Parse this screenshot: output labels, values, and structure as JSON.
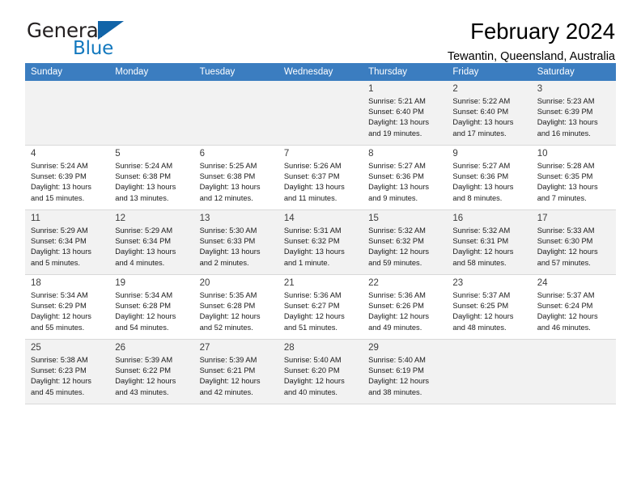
{
  "brand": {
    "name_part1": "General",
    "name_part2": "Blue",
    "flag_icon": "blue-triangle-flag",
    "accent_color": "#1278be",
    "flag_color": "#1164a8"
  },
  "header": {
    "title": "February 2024",
    "subtitle": "Tewantin, Queensland, Australia"
  },
  "calendar": {
    "header_bg": "#3b7dc0",
    "header_text_color": "#ffffff",
    "shaded_row_bg": "#f2f2f2",
    "weekdays": [
      "Sunday",
      "Monday",
      "Tuesday",
      "Wednesday",
      "Thursday",
      "Friday",
      "Saturday"
    ],
    "weeks": [
      [
        {
          "day": "",
          "lines": []
        },
        {
          "day": "",
          "lines": []
        },
        {
          "day": "",
          "lines": []
        },
        {
          "day": "",
          "lines": []
        },
        {
          "day": "1",
          "lines": [
            "Sunrise: 5:21 AM",
            "Sunset: 6:40 PM",
            "Daylight: 13 hours",
            "and 19 minutes."
          ]
        },
        {
          "day": "2",
          "lines": [
            "Sunrise: 5:22 AM",
            "Sunset: 6:40 PM",
            "Daylight: 13 hours",
            "and 17 minutes."
          ]
        },
        {
          "day": "3",
          "lines": [
            "Sunrise: 5:23 AM",
            "Sunset: 6:39 PM",
            "Daylight: 13 hours",
            "and 16 minutes."
          ]
        }
      ],
      [
        {
          "day": "4",
          "lines": [
            "Sunrise: 5:24 AM",
            "Sunset: 6:39 PM",
            "Daylight: 13 hours",
            "and 15 minutes."
          ]
        },
        {
          "day": "5",
          "lines": [
            "Sunrise: 5:24 AM",
            "Sunset: 6:38 PM",
            "Daylight: 13 hours",
            "and 13 minutes."
          ]
        },
        {
          "day": "6",
          "lines": [
            "Sunrise: 5:25 AM",
            "Sunset: 6:38 PM",
            "Daylight: 13 hours",
            "and 12 minutes."
          ]
        },
        {
          "day": "7",
          "lines": [
            "Sunrise: 5:26 AM",
            "Sunset: 6:37 PM",
            "Daylight: 13 hours",
            "and 11 minutes."
          ]
        },
        {
          "day": "8",
          "lines": [
            "Sunrise: 5:27 AM",
            "Sunset: 6:36 PM",
            "Daylight: 13 hours",
            "and 9 minutes."
          ]
        },
        {
          "day": "9",
          "lines": [
            "Sunrise: 5:27 AM",
            "Sunset: 6:36 PM",
            "Daylight: 13 hours",
            "and 8 minutes."
          ]
        },
        {
          "day": "10",
          "lines": [
            "Sunrise: 5:28 AM",
            "Sunset: 6:35 PM",
            "Daylight: 13 hours",
            "and 7 minutes."
          ]
        }
      ],
      [
        {
          "day": "11",
          "lines": [
            "Sunrise: 5:29 AM",
            "Sunset: 6:34 PM",
            "Daylight: 13 hours",
            "and 5 minutes."
          ]
        },
        {
          "day": "12",
          "lines": [
            "Sunrise: 5:29 AM",
            "Sunset: 6:34 PM",
            "Daylight: 13 hours",
            "and 4 minutes."
          ]
        },
        {
          "day": "13",
          "lines": [
            "Sunrise: 5:30 AM",
            "Sunset: 6:33 PM",
            "Daylight: 13 hours",
            "and 2 minutes."
          ]
        },
        {
          "day": "14",
          "lines": [
            "Sunrise: 5:31 AM",
            "Sunset: 6:32 PM",
            "Daylight: 13 hours",
            "and 1 minute."
          ]
        },
        {
          "day": "15",
          "lines": [
            "Sunrise: 5:32 AM",
            "Sunset: 6:32 PM",
            "Daylight: 12 hours",
            "and 59 minutes."
          ]
        },
        {
          "day": "16",
          "lines": [
            "Sunrise: 5:32 AM",
            "Sunset: 6:31 PM",
            "Daylight: 12 hours",
            "and 58 minutes."
          ]
        },
        {
          "day": "17",
          "lines": [
            "Sunrise: 5:33 AM",
            "Sunset: 6:30 PM",
            "Daylight: 12 hours",
            "and 57 minutes."
          ]
        }
      ],
      [
        {
          "day": "18",
          "lines": [
            "Sunrise: 5:34 AM",
            "Sunset: 6:29 PM",
            "Daylight: 12 hours",
            "and 55 minutes."
          ]
        },
        {
          "day": "19",
          "lines": [
            "Sunrise: 5:34 AM",
            "Sunset: 6:28 PM",
            "Daylight: 12 hours",
            "and 54 minutes."
          ]
        },
        {
          "day": "20",
          "lines": [
            "Sunrise: 5:35 AM",
            "Sunset: 6:28 PM",
            "Daylight: 12 hours",
            "and 52 minutes."
          ]
        },
        {
          "day": "21",
          "lines": [
            "Sunrise: 5:36 AM",
            "Sunset: 6:27 PM",
            "Daylight: 12 hours",
            "and 51 minutes."
          ]
        },
        {
          "day": "22",
          "lines": [
            "Sunrise: 5:36 AM",
            "Sunset: 6:26 PM",
            "Daylight: 12 hours",
            "and 49 minutes."
          ]
        },
        {
          "day": "23",
          "lines": [
            "Sunrise: 5:37 AM",
            "Sunset: 6:25 PM",
            "Daylight: 12 hours",
            "and 48 minutes."
          ]
        },
        {
          "day": "24",
          "lines": [
            "Sunrise: 5:37 AM",
            "Sunset: 6:24 PM",
            "Daylight: 12 hours",
            "and 46 minutes."
          ]
        }
      ],
      [
        {
          "day": "25",
          "lines": [
            "Sunrise: 5:38 AM",
            "Sunset: 6:23 PM",
            "Daylight: 12 hours",
            "and 45 minutes."
          ]
        },
        {
          "day": "26",
          "lines": [
            "Sunrise: 5:39 AM",
            "Sunset: 6:22 PM",
            "Daylight: 12 hours",
            "and 43 minutes."
          ]
        },
        {
          "day": "27",
          "lines": [
            "Sunrise: 5:39 AM",
            "Sunset: 6:21 PM",
            "Daylight: 12 hours",
            "and 42 minutes."
          ]
        },
        {
          "day": "28",
          "lines": [
            "Sunrise: 5:40 AM",
            "Sunset: 6:20 PM",
            "Daylight: 12 hours",
            "and 40 minutes."
          ]
        },
        {
          "day": "29",
          "lines": [
            "Sunrise: 5:40 AM",
            "Sunset: 6:19 PM",
            "Daylight: 12 hours",
            "and 38 minutes."
          ]
        },
        {
          "day": "",
          "lines": []
        },
        {
          "day": "",
          "lines": []
        }
      ]
    ]
  }
}
